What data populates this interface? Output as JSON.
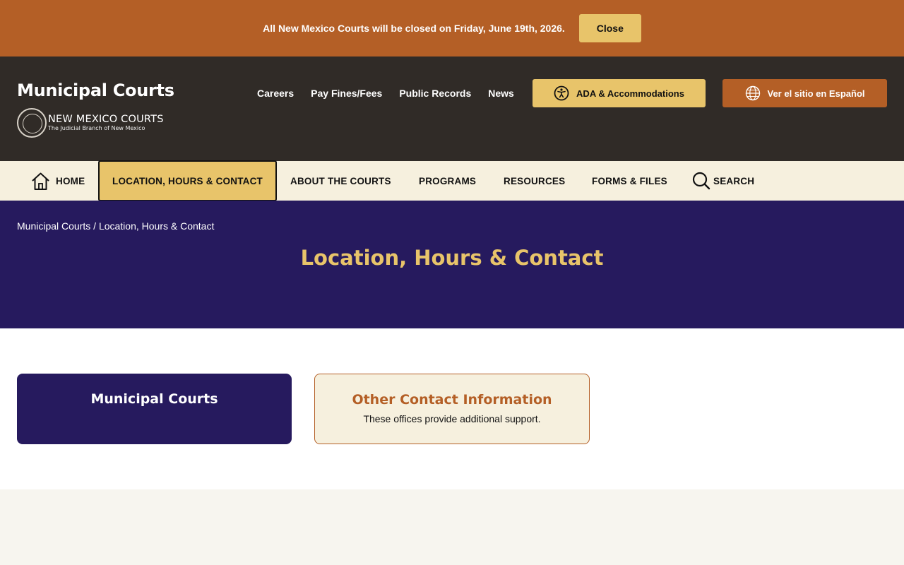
{
  "alert": {
    "message": "All New Mexico Courts will be closed on Friday, June 19th, 2026.",
    "close_label": "Close"
  },
  "header": {
    "site_title": "Municipal Courts",
    "logo_name": "NEW MEXICO COURTS",
    "logo_tagline": "The Judicial Branch of New Mexico",
    "util_links": [
      "Careers",
      "Pay Fines/Fees",
      "Public Records",
      "News"
    ],
    "ada_label": "ADA & Accommodations",
    "spanish_label": "Ver el sitio en Español"
  },
  "nav": {
    "home": "HOME",
    "location": "LOCATION, HOURS & CONTACT",
    "about": "ABOUT THE COURTS",
    "programs": "PROGRAMS",
    "resources": "RESOURCES",
    "forms": "FORMS & FILES",
    "search": "SEARCH"
  },
  "breadcrumb": {
    "root": "Municipal Courts",
    "separator": " / ",
    "current": "Location, Hours & Contact"
  },
  "page_title": "Location, Hours & Contact",
  "cards": [
    {
      "title": "Municipal Courts",
      "description": ""
    },
    {
      "title": "Other Contact Information",
      "description": "These offices provide additional support."
    }
  ],
  "colors": {
    "alert_bg": "#b45f26",
    "header_bg": "#302b27",
    "accent_gold": "#e8c46a",
    "hero_bg": "#261a5e",
    "nav_bg": "#f6f0de"
  },
  "icons": [
    "home-icon",
    "search-icon",
    "accessibility-icon",
    "globe-icon",
    "court-seal-icon"
  ]
}
